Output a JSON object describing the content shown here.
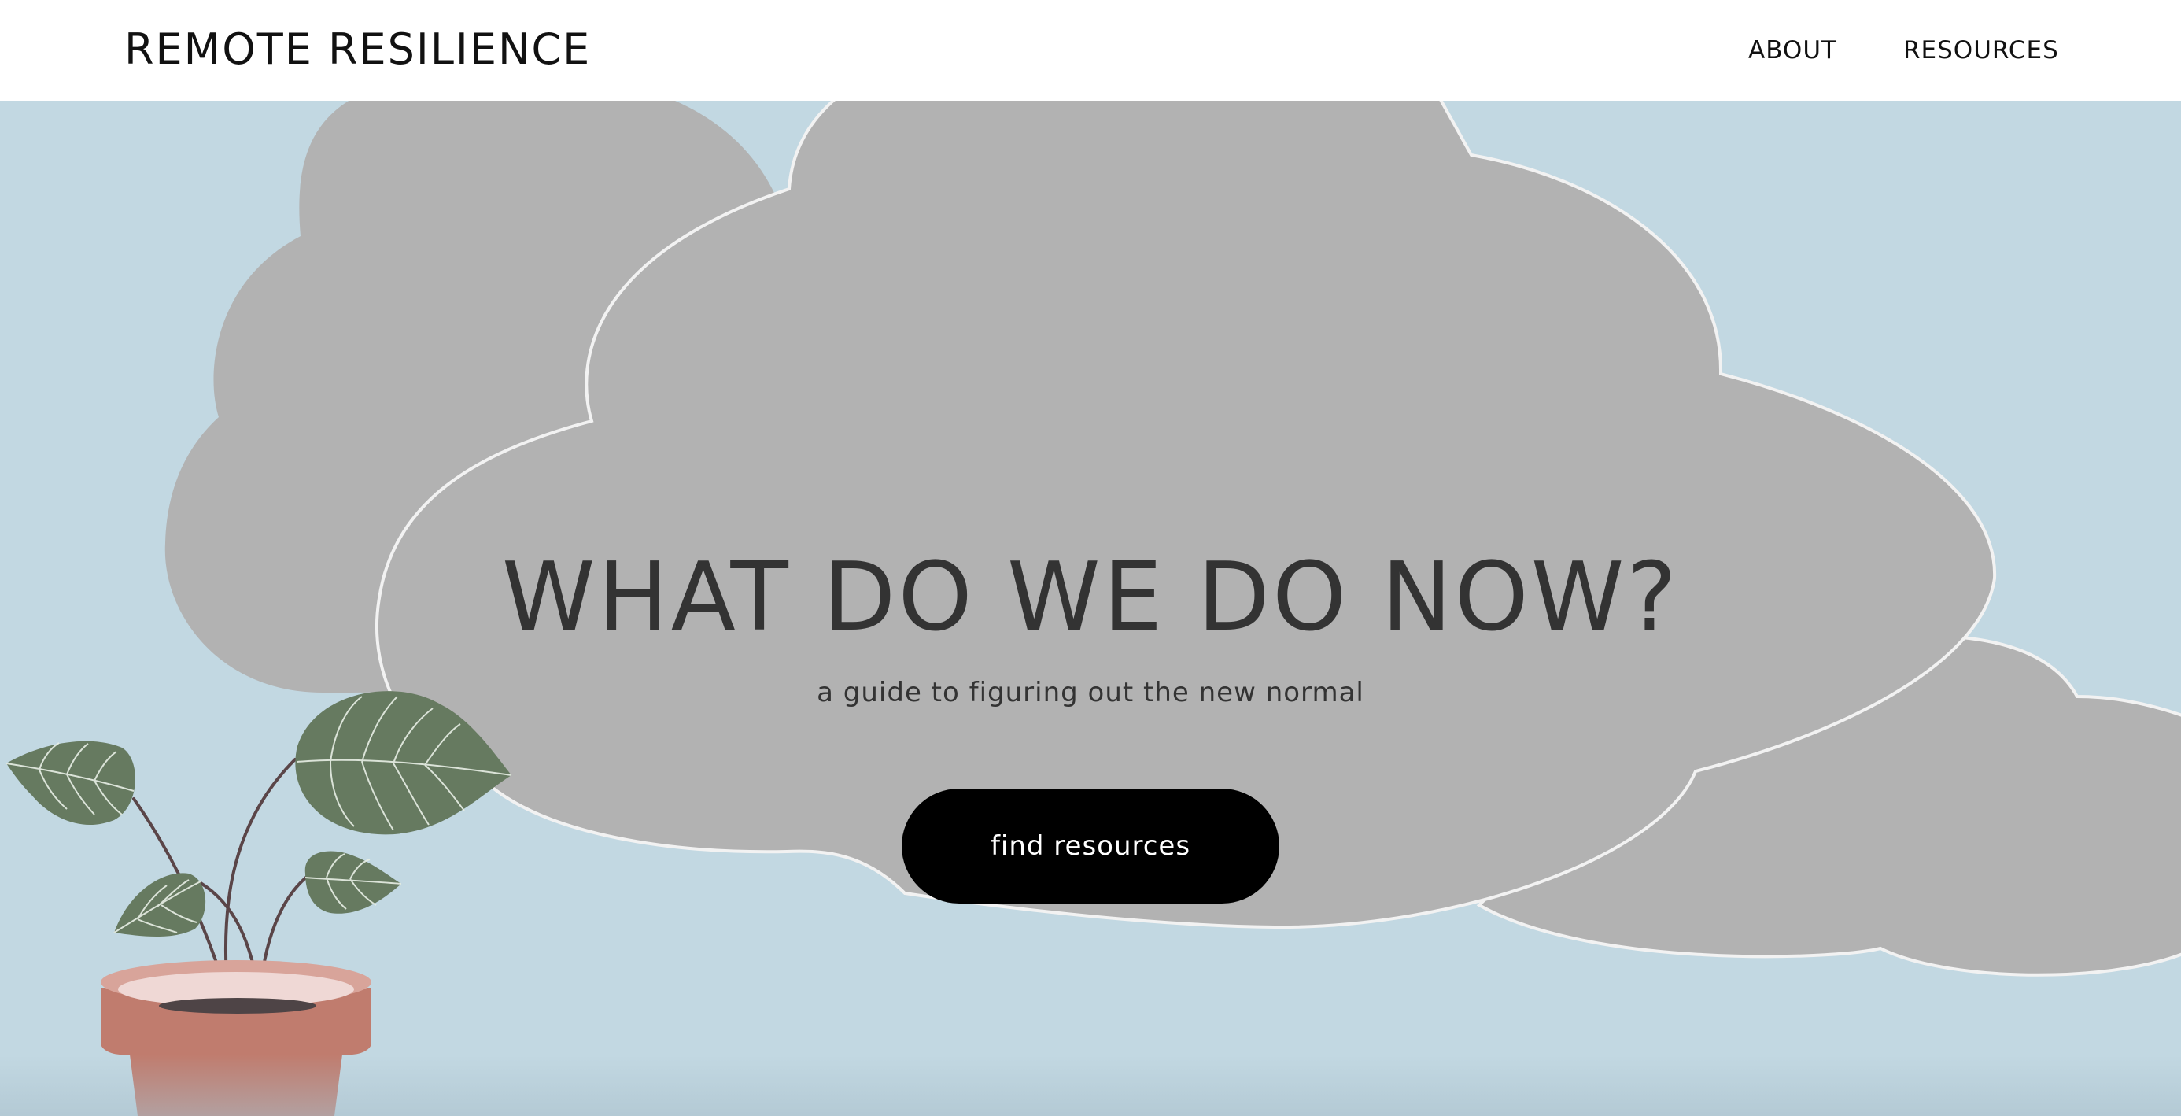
{
  "header": {
    "brand": "REMOTE RESILIENCE",
    "nav": [
      {
        "label": "ABOUT"
      },
      {
        "label": "RESOURCES"
      }
    ]
  },
  "hero": {
    "title": "WHAT DO WE DO NOW?",
    "subtitle": "a guide to figuring out the new normal",
    "cta_label": "find resources"
  },
  "colors": {
    "sky": "#c2d8e2",
    "cloud": "#b2b2b2",
    "cloud_outline": "#f2f2f2",
    "leaf": "#667a60",
    "stem": "#5a4548",
    "pot": "#c07c6e",
    "pot_rim": "#d8a49a",
    "soil": "#4e4446",
    "button_bg": "#000000",
    "button_text": "#ffffff"
  },
  "illustration": {
    "icons": [
      "cloud-icon",
      "potted-plant-icon"
    ]
  }
}
